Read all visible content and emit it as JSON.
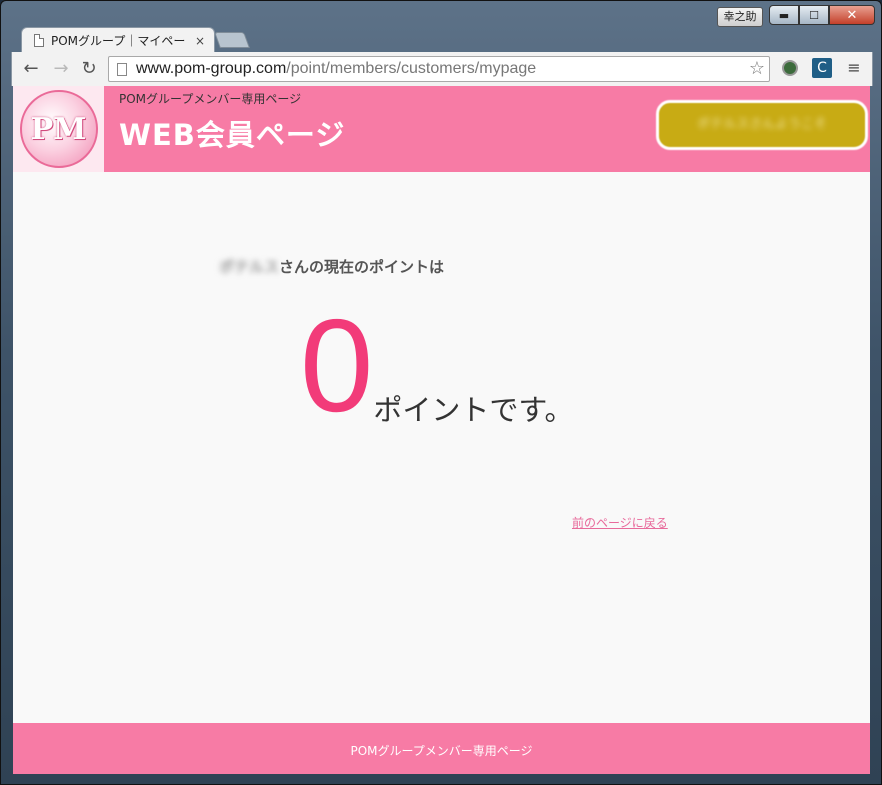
{
  "window": {
    "profile_name": "幸之助",
    "minimize": "▬",
    "maximize": "☐",
    "close": "✕"
  },
  "tabs": [
    {
      "title": "POMグループ｜マイペー",
      "close": "×"
    }
  ],
  "toolbar": {
    "back": "←",
    "forward": "→",
    "reload": "↻",
    "url_host": "www.pom-group.com",
    "url_path": "/point/members/customers/mypage",
    "star": "☆",
    "ext2": "C",
    "menu": "≡"
  },
  "header": {
    "logo_text": "PM",
    "subtitle": "POMグループメンバー専用ページ",
    "title": "WEB会員ページ",
    "user_button": "ポテルスさんようこそ"
  },
  "main": {
    "member_name": "ポテルス",
    "points_label_suffix": "さんの現在のポイントは",
    "points_value": "0",
    "points_unit": "ポイントです。",
    "back_link": "前のページに戻る"
  },
  "footer": {
    "text": "POMグループメンバー専用ページ"
  }
}
